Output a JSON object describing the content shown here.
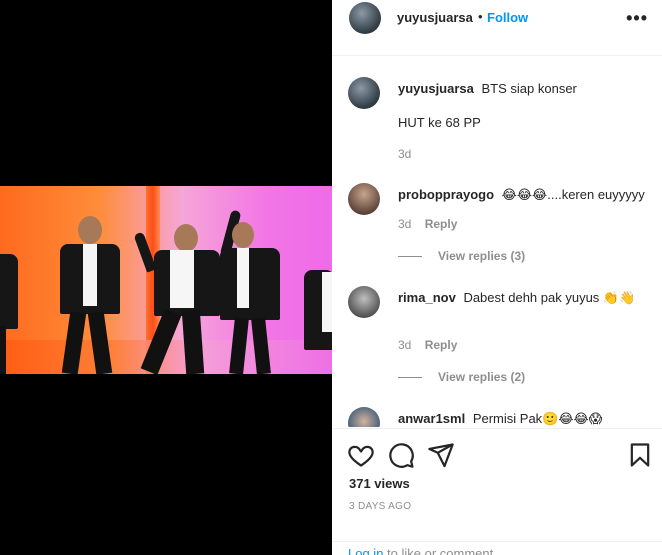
{
  "post": {
    "username": "yuyusjuarsa",
    "separator": "•",
    "follow_label": "Follow",
    "more_icon": "more-horizontal-icon"
  },
  "comments": [
    {
      "username": "yuyusjuarsa",
      "text": "BTS siap konser",
      "text2": "HUT ke 68 PP",
      "time": "3d"
    },
    {
      "username": "probopprayogo",
      "text": "😂😂😂....keren euyyyyy",
      "time": "3d",
      "reply_label": "Reply",
      "view_replies": "View replies (3)"
    },
    {
      "username": "rima_nov",
      "text": "Dabest dehh pak yuyus 👏👋",
      "time": "3d",
      "reply_label": "Reply",
      "view_replies": "View replies (2)"
    },
    {
      "username": "anwar1sml",
      "text": "Permisi Pak🙂😂😂😱"
    }
  ],
  "actions": {
    "views": "371 views",
    "ago": "3 DAYS AGO",
    "login_link": "Log in",
    "login_text": " to like or comment."
  },
  "colors": {
    "accent": "#0095f6",
    "muted": "#8e8e8e",
    "text": "#262626"
  }
}
